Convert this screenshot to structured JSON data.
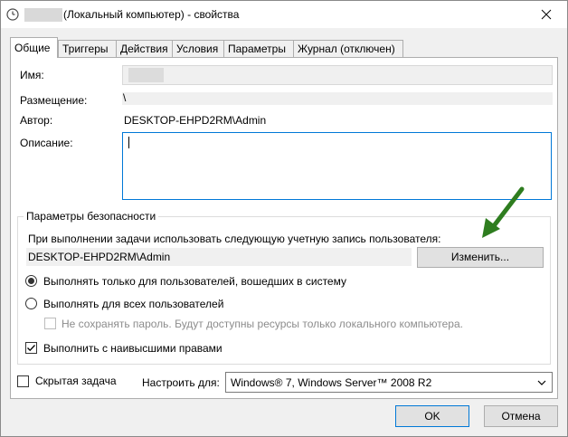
{
  "window": {
    "title": "(Локальный компьютер) - свойства"
  },
  "tabs": [
    {
      "label": "Общие",
      "active": true
    },
    {
      "label": "Триггеры",
      "active": false
    },
    {
      "label": "Действия",
      "active": false
    },
    {
      "label": "Условия",
      "active": false
    },
    {
      "label": "Параметры",
      "active": false
    },
    {
      "label": "Журнал (отключен)",
      "active": false
    }
  ],
  "general": {
    "name_label": "Имя:",
    "location_label": "Размещение:",
    "location_value": "\\",
    "author_label": "Автор:",
    "author_value": "DESKTOP-EHPD2RM\\Admin",
    "description_label": "Описание:",
    "description_value": ""
  },
  "security": {
    "group_title": "Параметры безопасности",
    "run_as_text": "При выполнении задачи использовать следующую учетную запись пользователя:",
    "account_value": "DESKTOP-EHPD2RM\\Admin",
    "change_button": "Изменить...",
    "radio_logged_on": "Выполнять только для пользователей, вошедших в систему",
    "radio_all_users": "Выполнять для всех пользователей",
    "no_store_password": "Не сохранять пароль. Будут доступны ресурсы только локального компьютера.",
    "highest_privileges": "Выполнить с наивысшими правами",
    "selected_radio": "logged_on",
    "highest_privileges_checked": true
  },
  "bottom": {
    "hidden_task": "Скрытая задача",
    "configure_for_label": "Настроить для:",
    "configure_for_value": "Windows® 7, Windows Server™ 2008 R2",
    "ok_button": "OK",
    "cancel_button": "Отмена"
  },
  "colors": {
    "accent": "#0078d7",
    "annotation_arrow": "#2e7d1f"
  },
  "icons": [
    "clock-icon",
    "close-icon",
    "chevron-down-icon",
    "checkmark-icon",
    "green-arrow-icon"
  ]
}
